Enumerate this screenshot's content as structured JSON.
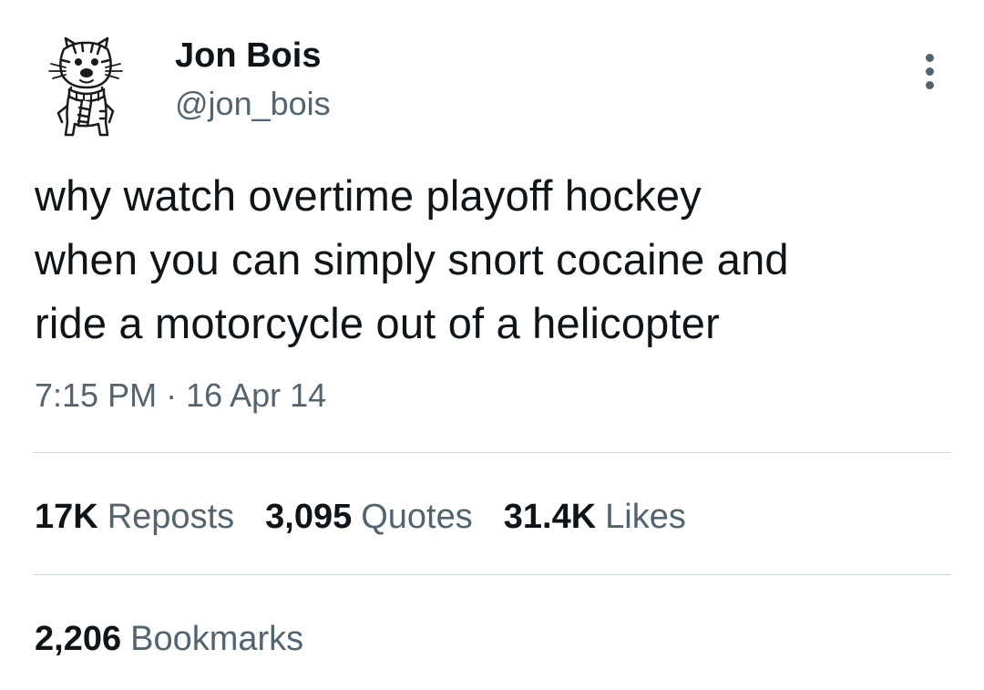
{
  "author": {
    "display_name": "Jon Bois",
    "handle": "@jon_bois",
    "avatar_icon": "hobbes-sketch-avatar"
  },
  "tweet": {
    "text": "why watch overtime playoff hockey\nwhen you can simply snort cocaine and\nride a motorcycle out of a helicopter",
    "time": "7:15 PM",
    "separator": "·",
    "date": "16 Apr 14"
  },
  "stats": {
    "reposts": {
      "count": "17K",
      "label": "Reposts"
    },
    "quotes": {
      "count": "3,095",
      "label": "Quotes"
    },
    "likes": {
      "count": "31.4K",
      "label": "Likes"
    },
    "bookmarks": {
      "count": "2,206",
      "label": "Bookmarks"
    }
  },
  "icons": {
    "more": "more-vertical-icon"
  },
  "colors": {
    "primary_text": "#0f1419",
    "secondary_text": "#536471",
    "divider": "#cfd9de",
    "background": "#ffffff"
  }
}
